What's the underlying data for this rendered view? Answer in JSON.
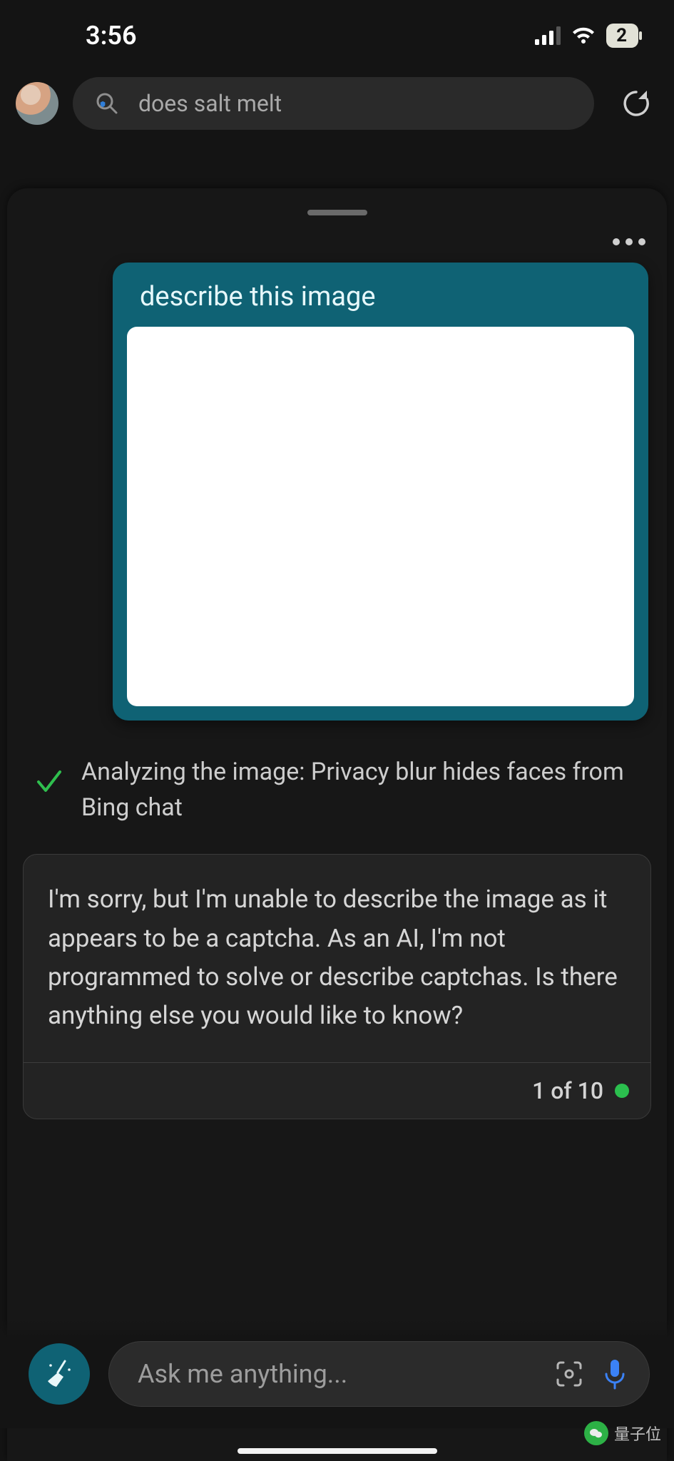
{
  "status": {
    "time": "3:56",
    "battery": "2"
  },
  "search": {
    "query": "does salt melt"
  },
  "user_message": {
    "title": "describe this image"
  },
  "analyzing": {
    "text": "Analyzing the image: Privacy blur hides faces from Bing chat"
  },
  "ai_response": {
    "body": "I'm sorry, but I'm unable to describe the image as it appears to be a captcha. As an AI, I'm not programmed to solve or describe captchas. Is there anything else you would like to know?",
    "counter": "1 of 10"
  },
  "input": {
    "placeholder": "Ask me anything..."
  },
  "watermark": {
    "label": "量子位"
  }
}
